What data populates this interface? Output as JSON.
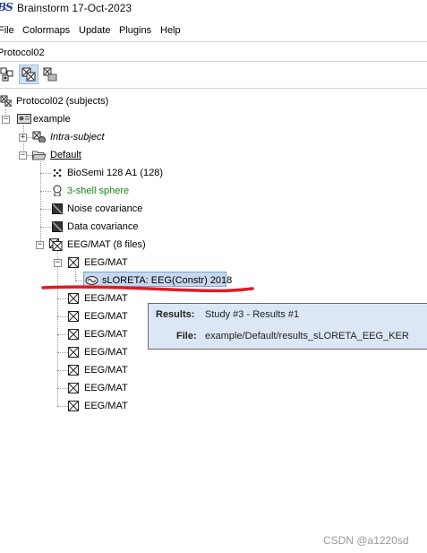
{
  "window": {
    "logo_text": "BS",
    "title": "Brainstorm 17-Oct-2023"
  },
  "menu": {
    "items": [
      "File",
      "Colormaps",
      "Update",
      "Plugins",
      "Help"
    ]
  },
  "protocol_selector": {
    "value": "Protocol02"
  },
  "toolbar": {
    "buttons": [
      {
        "icon": "functional-view-icon",
        "active": false
      },
      {
        "icon": "anatomy-view-icon",
        "active": true
      },
      {
        "icon": "studies-view-icon",
        "active": false
      }
    ]
  },
  "tree": {
    "root": "Protocol02 (subjects)",
    "subject": "example",
    "intra_subject": "Intra-subject",
    "default_condition": "Default",
    "channel_file": "BioSemi 128 A1 (128)",
    "headmodel": "3-shell sphere",
    "noise_cov": "Noise covariance",
    "data_cov": "Data covariance",
    "data_list": "EEG/MAT (8 files)",
    "data_item": "EEG/MAT",
    "result_item": "sLORETA: EEG(Constr) 2018",
    "data_items_after": [
      "EEG/MAT",
      "EEG/MAT",
      "EEG/MAT",
      "EEG/MAT",
      "EEG/MAT",
      "EEG/MAT",
      "EEG/MAT"
    ]
  },
  "tooltip": {
    "results_key": "Results:",
    "results_val": "Study #3 - Results #1",
    "file_key": "File:",
    "file_val": "example/Default/results_sLORETA_EEG_KER"
  },
  "annotation": {
    "color": "#e01b24"
  },
  "watermark": "CSDN @a1220sd"
}
